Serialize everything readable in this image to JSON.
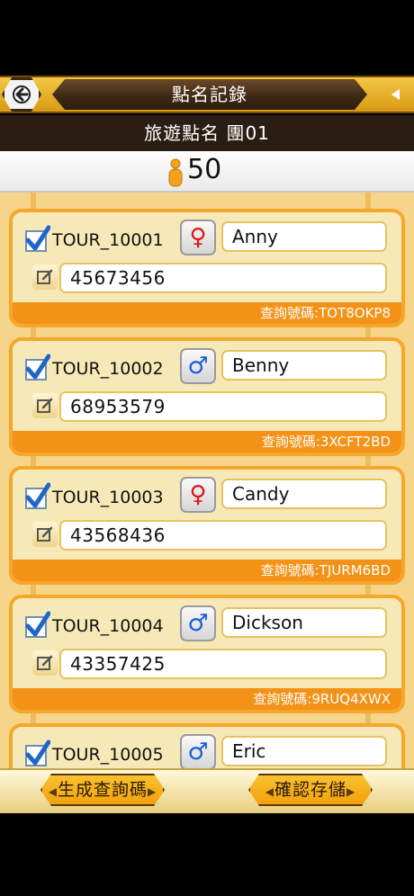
{
  "header": {
    "title": "點名記錄"
  },
  "group": {
    "name": "旅遊點名 團01"
  },
  "summary": {
    "count": "50"
  },
  "tourists": [
    {
      "id": "TOUR_10001",
      "gender": "female",
      "gender_symbol": "♀",
      "name": "Anny",
      "phone": "45673456",
      "query": "查詢號碼:TOT8OKP8"
    },
    {
      "id": "TOUR_10002",
      "gender": "male",
      "gender_symbol": "♂",
      "name": "Benny",
      "phone": "68953579",
      "query": "查詢號碼:3XCFT2BD"
    },
    {
      "id": "TOUR_10003",
      "gender": "female",
      "gender_symbol": "♀",
      "name": "Candy",
      "phone": "43568436",
      "query": "查詢號碼:TJURM6BD"
    },
    {
      "id": "TOUR_10004",
      "gender": "male",
      "gender_symbol": "♂",
      "name": "Dickson",
      "phone": "43357425",
      "query": "查詢號碼:9RUQ4XWX"
    },
    {
      "id": "TOUR_10005",
      "gender": "male",
      "gender_symbol": "♂",
      "name": "Eric",
      "phone": "",
      "query": ""
    }
  ],
  "actions": {
    "generate_label": "生成查詢碼",
    "save_label": "確認存儲"
  },
  "colors": {
    "accent_orange": "#f39217",
    "card_bg": "#f7e9b7",
    "title_gold": "#f3c744",
    "female_red": "#d81a1a",
    "male_blue": "#1a5fd8"
  }
}
